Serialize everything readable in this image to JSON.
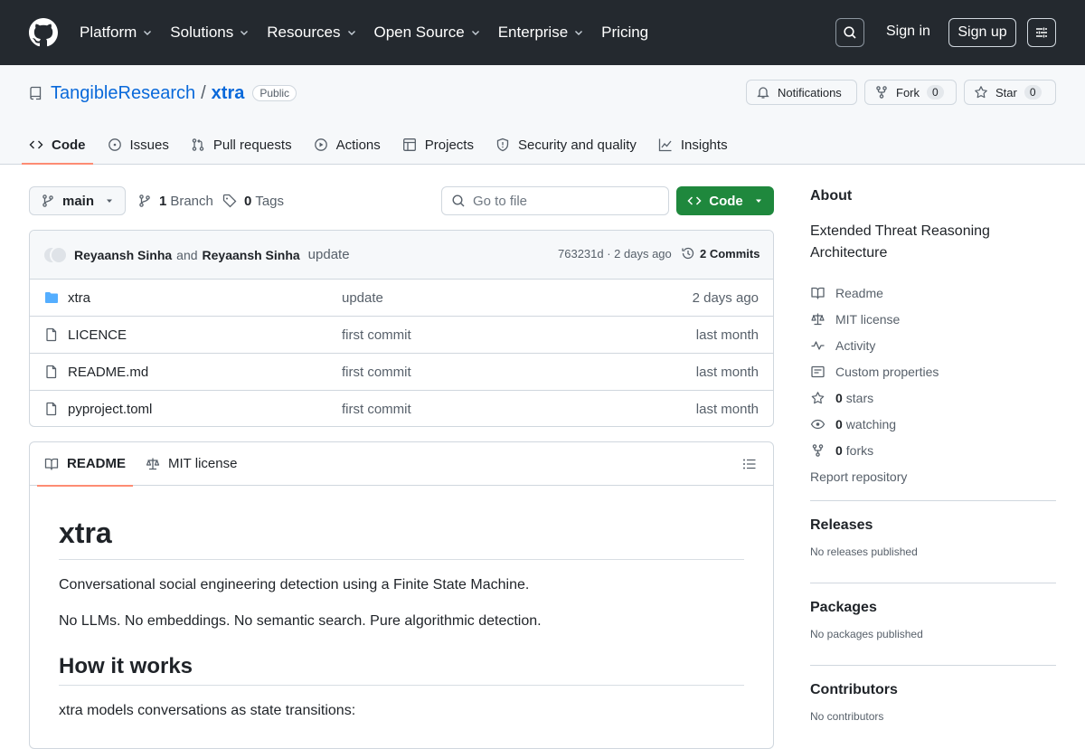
{
  "nav": {
    "items": [
      "Platform",
      "Solutions",
      "Resources",
      "Open Source",
      "Enterprise",
      "Pricing"
    ],
    "sign_in": "Sign in",
    "sign_up": "Sign up"
  },
  "repo": {
    "owner": "TangibleResearch",
    "name": "xtra",
    "visibility": "Public",
    "notifications_label": "Notifications",
    "fork_label": "Fork",
    "fork_count": "0",
    "star_label": "Star",
    "star_count": "0"
  },
  "tabs": [
    "Code",
    "Issues",
    "Pull requests",
    "Actions",
    "Projects",
    "Security and quality",
    "Insights"
  ],
  "toolbar": {
    "branch": "main",
    "branch_count": "1",
    "branch_label": "Branch",
    "tag_count": "0",
    "tag_label": "Tags",
    "goto_placeholder": "Go to file",
    "code_button": "Code"
  },
  "commit": {
    "author1": "Reyaansh Sinha",
    "and": "and",
    "author2": "Reyaansh Sinha",
    "message": "update",
    "meta": "763231d · 2 days ago",
    "commits_label": "2 Commits"
  },
  "files": [
    {
      "name": "xtra",
      "type": "folder",
      "message": "update",
      "age": "2 days ago"
    },
    {
      "name": "LICENCE",
      "type": "file",
      "message": "first commit",
      "age": "last month"
    },
    {
      "name": "README.md",
      "type": "file",
      "message": "first commit",
      "age": "last month"
    },
    {
      "name": "pyproject.toml",
      "type": "file",
      "message": "first commit",
      "age": "last month"
    }
  ],
  "readme": {
    "tab_readme": "README",
    "tab_license": "MIT license",
    "title": "xtra",
    "p1": "Conversational social engineering detection using a Finite State Machine.",
    "p2": "No LLMs. No embeddings. No semantic search. Pure algorithmic detection.",
    "h2": "How it works",
    "p3": "xtra models conversations as state transitions:"
  },
  "about": {
    "heading": "About",
    "description": "Extended Threat Reasoning Architecture",
    "readme": "Readme",
    "license": "MIT license",
    "activity": "Activity",
    "custom_properties": "Custom properties",
    "stars_count": "0",
    "stars_label": "stars",
    "watching_count": "0",
    "watching_label": "watching",
    "forks_count": "0",
    "forks_label": "forks",
    "report": "Report repository"
  },
  "releases": {
    "heading": "Releases",
    "text": "No releases published"
  },
  "packages": {
    "heading": "Packages",
    "text": "No packages published"
  },
  "contributors": {
    "heading": "Contributors",
    "text": "No contributors"
  },
  "colors": {
    "header_bg": "#24292f",
    "accent": "#0969da",
    "code_button": "#1f883d",
    "tab_underline": "#fd8c73"
  }
}
